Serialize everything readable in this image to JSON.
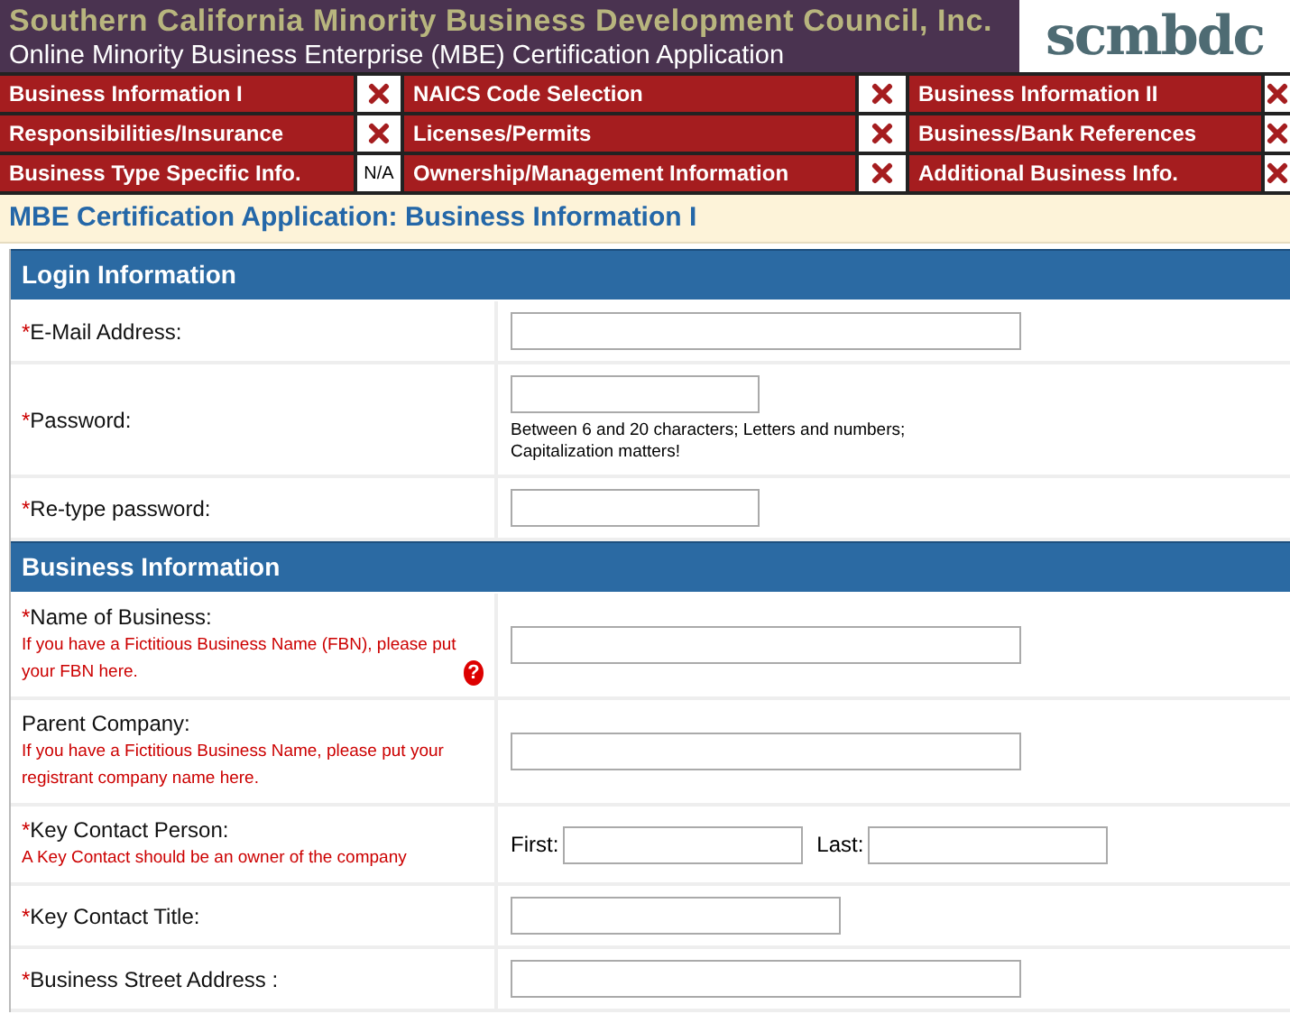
{
  "header": {
    "title": "Southern California Minority Business Development Council, Inc.",
    "subtitle": "Online Minority Business Enterprise (MBE) Certification Application",
    "logo": "scmbdc"
  },
  "nav": [
    {
      "label": "Business Information I",
      "kind": "x"
    },
    {
      "label": "NAICS Code Selection",
      "kind": "x"
    },
    {
      "label": "Business Information II",
      "kind": "x"
    },
    {
      "label": "Responsibilities/Insurance",
      "kind": "x"
    },
    {
      "label": "Licenses/Permits",
      "kind": "x"
    },
    {
      "label": "Business/Bank References",
      "kind": "x"
    },
    {
      "label": "Business Type Specific Info.",
      "kind": "text",
      "status": "N/A"
    },
    {
      "label": "Ownership/Management Information",
      "kind": "x"
    },
    {
      "label": "Additional Business Info.",
      "kind": "x"
    }
  ],
  "page_title": "MBE Certification Application: Business Information I",
  "sections": [
    {
      "title": "Login Information",
      "fields": [
        {
          "mark": "*",
          "label": "E-Mail Address:",
          "kind": "long"
        },
        {
          "mark": "*",
          "label": "Password:",
          "kind": "short",
          "field_hint": "Between 6 and 20 characters; Letters and numbers; Capitalization matters!"
        },
        {
          "mark": "*",
          "label": "Re-type password:",
          "kind": "short"
        }
      ]
    },
    {
      "title": "Business Information",
      "fields": [
        {
          "mark": "*",
          "label": "Name of Business:",
          "kind": "long",
          "hint": "If you have a Fictitious Business Name (FBN), please put your FBN here.",
          "help": "?"
        },
        {
          "label": "Parent Company:",
          "kind": "long",
          "hint": "If you have a Fictitious Business Name, please put your registrant company name here."
        },
        {
          "mark": "*",
          "label": "Key Contact Person:",
          "kind": "name",
          "hint": "A Key Contact should be an owner of the company",
          "first": "First:",
          "last": "Last:"
        },
        {
          "mark": "*",
          "label": "Key Contact Title:",
          "kind": "medium"
        },
        {
          "mark": "*",
          "label": "Business Street Address :",
          "kind": "long"
        }
      ]
    }
  ]
}
